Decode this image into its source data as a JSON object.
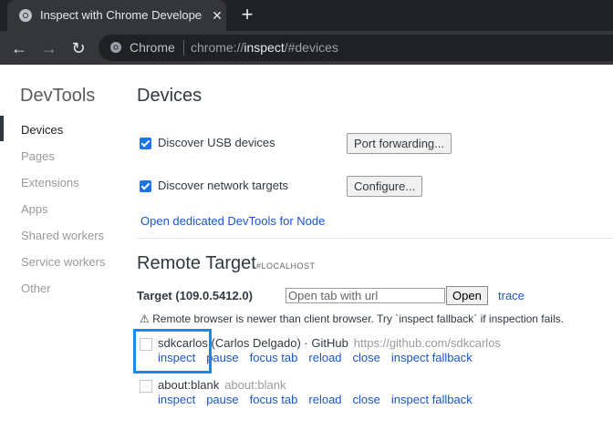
{
  "browser": {
    "tab_title": "Inspect with Chrome Developer Tools",
    "tab_close_icon": "close-icon",
    "new_tab_icon": "plus-icon",
    "back_icon": "arrow-left-icon",
    "forward_icon": "arrow-right-icon",
    "reload_icon": "reload-icon",
    "site_label": "Chrome",
    "url_scheme": "chrome://",
    "url_host": "inspect",
    "url_path": "/#devices"
  },
  "sidebar": {
    "title": "DevTools",
    "items": [
      {
        "label": "Devices",
        "selected": true
      },
      {
        "label": "Pages"
      },
      {
        "label": "Extensions"
      },
      {
        "label": "Apps"
      },
      {
        "label": "Shared workers"
      },
      {
        "label": "Service workers"
      },
      {
        "label": "Other"
      }
    ]
  },
  "devices": {
    "title": "Devices",
    "usb_label": "Discover USB devices",
    "usb_checked": true,
    "port_forwarding_btn": "Port forwarding...",
    "network_label": "Discover network targets",
    "network_checked": true,
    "configure_btn": "Configure...",
    "node_link": "Open dedicated DevTools for Node"
  },
  "remote": {
    "title": "Remote Target",
    "subtitle": "#LOCALHOST",
    "target_label": "Target (109.0.5412.0)",
    "url_placeholder": "Open tab with url",
    "open_btn": "Open",
    "trace_link": "trace",
    "warning_icon": "warning-icon",
    "warning": "Remote browser is newer than client browser. Try `inspect fallback` if inspection fails.",
    "targets": [
      {
        "name": "sdkcarlos (Carlos Delgado) · GitHub",
        "url": "https://github.com/sdkcarlos",
        "actions": [
          "inspect",
          "pause",
          "focus tab",
          "reload",
          "close",
          "inspect fallback"
        ]
      },
      {
        "name": "about:blank",
        "url": "about:blank",
        "actions": [
          "inspect",
          "pause",
          "focus tab",
          "reload",
          "close",
          "inspect fallback"
        ]
      }
    ]
  },
  "colors": {
    "link": "#1a57c4",
    "checkbox": "#1a73e8",
    "highlight": "#1e88e5"
  }
}
